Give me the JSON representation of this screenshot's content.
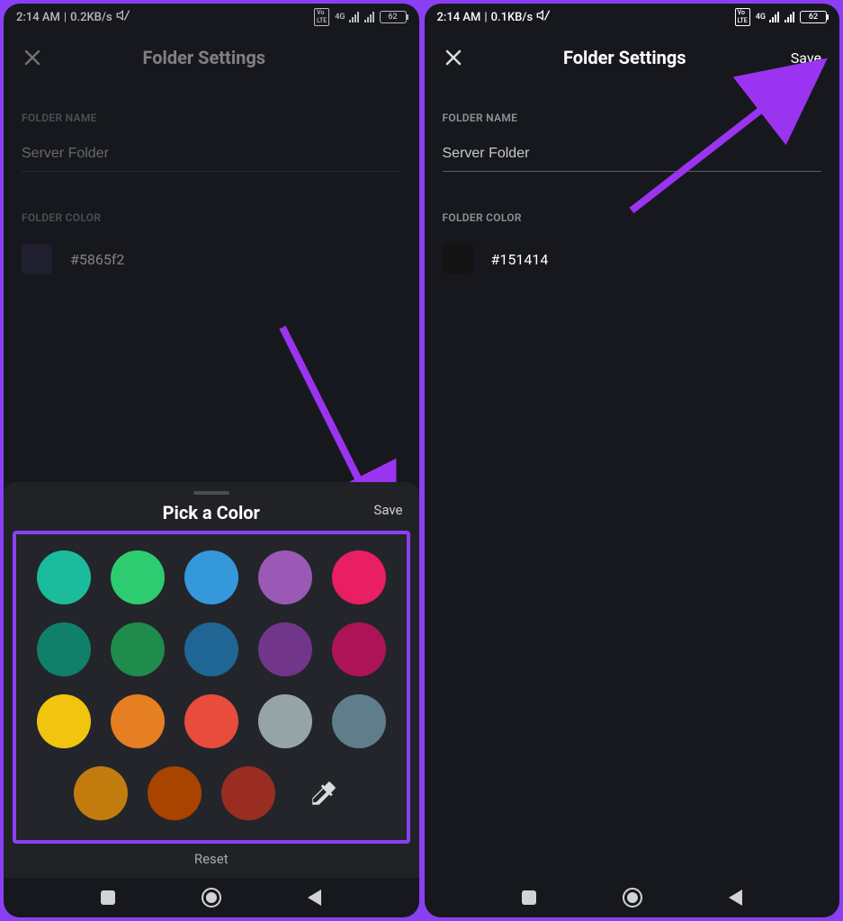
{
  "status": {
    "left_time": "2:14 AM",
    "left_speed_left": "0.2KB/s",
    "left_speed_right": "0.1KB/s",
    "battery": "62",
    "net_label": "4G"
  },
  "left": {
    "header_title": "Folder Settings",
    "folder_name_label": "FOLDER NAME",
    "folder_name_value": "Server Folder",
    "folder_color_label": "FOLDER COLOR",
    "folder_color_hex": "#5865f2",
    "folder_color_swatch": "#2e2a4a",
    "sheet_title": "Pick a Color",
    "sheet_save": "Save",
    "reset": "Reset",
    "colors_row1": [
      "#1abc9c",
      "#2ecc71",
      "#3498db",
      "#9b59b6",
      "#e91e63"
    ],
    "colors_row2": [
      "#11806a",
      "#1f8b4c",
      "#206694",
      "#71368a",
      "#ad1457"
    ],
    "colors_row3": [
      "#f1c40f",
      "#e67e22",
      "#e74c3c",
      "#95a5a6",
      "#607d8b"
    ],
    "colors_row4": [
      "#c27c0e",
      "#a84300",
      "#992d22"
    ]
  },
  "right": {
    "header_title": "Folder Settings",
    "save": "Save",
    "folder_name_label": "FOLDER NAME",
    "folder_name_value": "Server Folder",
    "folder_color_label": "FOLDER COLOR",
    "folder_color_hex": "#151414",
    "folder_color_swatch": "#151414"
  }
}
